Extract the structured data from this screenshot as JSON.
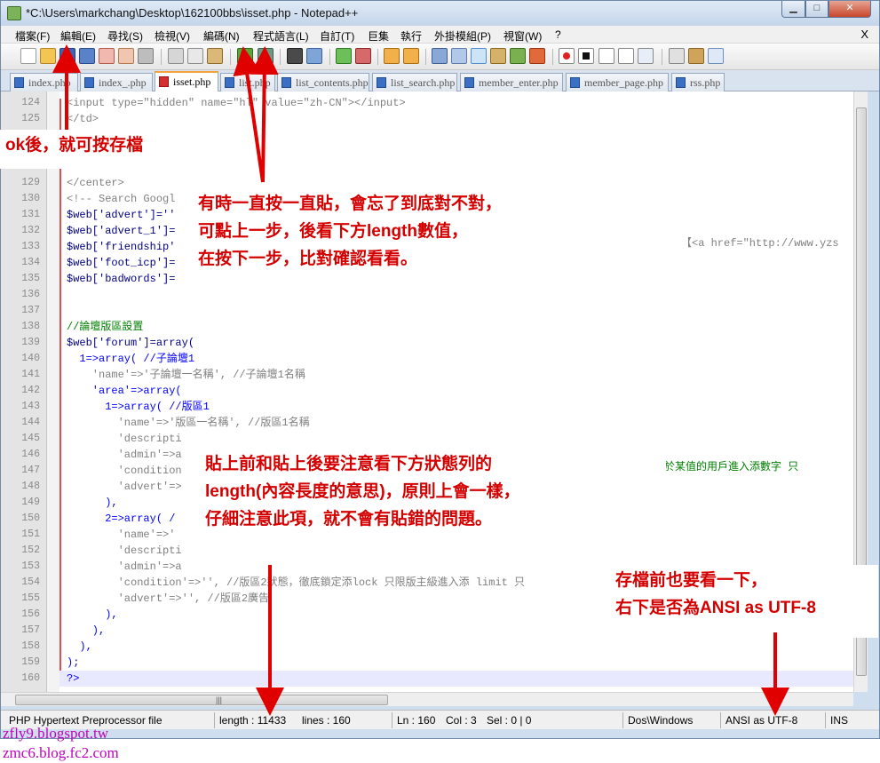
{
  "window": {
    "title": "*C:\\Users\\markchang\\Desktop\\162100bbs\\isset.php - Notepad++",
    "min_icon": "minimize-icon",
    "max_icon": "maximize-icon",
    "close_icon": "close-icon"
  },
  "menubar": {
    "items": [
      "檔案(F)",
      "編輯(E)",
      "尋找(S)",
      "檢視(V)",
      "編碼(N)",
      "程式語言(L)",
      "自訂(T)",
      "巨集",
      "執行",
      "外掛模組(P)",
      "視窗(W)",
      "?"
    ],
    "close": "X"
  },
  "tabs": [
    {
      "label": "index.php",
      "active": false
    },
    {
      "label": "index_.php",
      "active": false
    },
    {
      "label": "isset.php",
      "active": true
    },
    {
      "label": "list.php",
      "active": false
    },
    {
      "label": "list_contents.php",
      "active": false
    },
    {
      "label": "list_search.php",
      "active": false
    },
    {
      "label": "member_enter.php",
      "active": false
    },
    {
      "label": "member_page.php",
      "active": false
    },
    {
      "label": "rss.php",
      "active": false
    }
  ],
  "editor": {
    "lines": [
      {
        "n": "124",
        "text": "<input type=\"hidden\" name=\"hl\" value=\"zh-CN\"></input>",
        "cls": "s"
      },
      {
        "n": "125",
        "text": "</td>",
        "cls": "s"
      },
      {
        "n": "126",
        "text": "",
        "cls": ""
      },
      {
        "n": "127",
        "text": "",
        "cls": ""
      },
      {
        "n": "128",
        "text": "",
        "cls": ""
      },
      {
        "n": "129",
        "text": "</center>",
        "cls": "s"
      },
      {
        "n": "130",
        "text": "<!-- Search Googl",
        "cls": "s"
      },
      {
        "n": "131",
        "text": "$web['advert']=''",
        "cls": "v"
      },
      {
        "n": "132",
        "text": "$web['advert_1']=",
        "cls": "v"
      },
      {
        "n": "133",
        "text": "$web['friendship'",
        "cls": "v"
      },
      {
        "n": "134",
        "text": "$web['foot_icp']=",
        "cls": "v"
      },
      {
        "n": "135",
        "text": "$web['badwords']=",
        "cls": "v"
      },
      {
        "n": "136",
        "text": "",
        "cls": ""
      },
      {
        "n": "137",
        "text": "",
        "cls": ""
      },
      {
        "n": "138",
        "text": "//論壇版區設置",
        "cls": "c"
      },
      {
        "n": "139",
        "text": "$web['forum']=array(",
        "cls": "v"
      },
      {
        "n": "140",
        "text": "  1=>array( //子論壇1",
        "cls": "k"
      },
      {
        "n": "141",
        "text": "    'name'=>'子論壇一名稱', //子論壇1名稱",
        "cls": "s"
      },
      {
        "n": "142",
        "text": "    'area'=>array(",
        "cls": "k"
      },
      {
        "n": "143",
        "text": "      1=>array( //版區1",
        "cls": "k"
      },
      {
        "n": "144",
        "text": "        'name'=>'版區一名稱', //版區1名稱",
        "cls": "s"
      },
      {
        "n": "145",
        "text": "        'descripti",
        "cls": "s"
      },
      {
        "n": "146",
        "text": "        'admin'=>a",
        "cls": "s"
      },
      {
        "n": "147",
        "text": "        'condition",
        "cls": "s"
      },
      {
        "n": "148",
        "text": "        'advert'=>",
        "cls": "s"
      },
      {
        "n": "149",
        "text": "      ),",
        "cls": "k"
      },
      {
        "n": "150",
        "text": "      2=>array( /",
        "cls": "k"
      },
      {
        "n": "151",
        "text": "        'name'=>'",
        "cls": "s"
      },
      {
        "n": "152",
        "text": "        'descripti",
        "cls": "s"
      },
      {
        "n": "153",
        "text": "        'admin'=>a",
        "cls": "s"
      },
      {
        "n": "154",
        "text": "        'condition'=>'', //版區2狀態，徹底鎖定添lock 只限版主級進入添 limit 只",
        "cls": "s"
      },
      {
        "n": "155",
        "text": "        'advert'=>'', //版區2廣告",
        "cls": "s"
      },
      {
        "n": "156",
        "text": "      ),",
        "cls": "k"
      },
      {
        "n": "157",
        "text": "    ),",
        "cls": "k"
      },
      {
        "n": "158",
        "text": "  ),",
        "cls": "k"
      },
      {
        "n": "159",
        "text": ");",
        "cls": "k"
      },
      {
        "n": "160",
        "text": "?>",
        "cls": "k"
      }
    ],
    "fragment_133": "【<a href=\"http://www.yzs",
    "fragment_147": "大於某值的用戶進入添數字 只"
  },
  "status": {
    "filetype": "PHP Hypertext Preprocessor file",
    "length": "length : 11433",
    "lines": "lines : 160",
    "pos": "Ln : 160",
    "col": "Col : 3",
    "sel": "Sel : 0 | 0",
    "eol": "Dos\\Windows",
    "encoding": "ANSI as UTF-8",
    "mode": "INS"
  },
  "notes": {
    "n1": "ok後，就可按存檔",
    "n2a": "有時一直按一直貼，會忘了到底對不對，",
    "n2b": "可點上一步，後看下方length數值，",
    "n2c": "在按下一步，比對確認看看。",
    "n3a": "貼上前和貼上後要注意看下方狀態列的",
    "n3b": "length(內容長度的意思)，原則上會一樣，",
    "n3c": "仔細注意此項，就不會有貼錯的問題。",
    "n4a": "存檔前也要看一下，",
    "n4b": "右下是否為ANSI as UTF-8"
  },
  "watermark": {
    "line1": "zfly9.blogspot.tw",
    "line2": "zmc6.blog.fc2.com"
  },
  "colors": {
    "annotation": "#d40000",
    "arrow": "#e00000",
    "watermark": "#c000c0",
    "active_tab_accent": "#f2a33a"
  }
}
